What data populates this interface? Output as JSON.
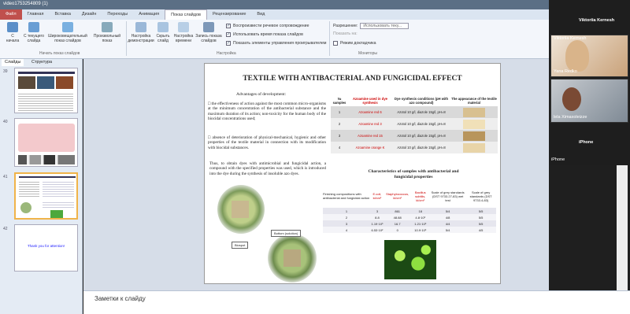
{
  "window": {
    "title": "video1753254809 (1)"
  },
  "tabs": [
    "Файл",
    "Главная",
    "Вставка",
    "Дизайн",
    "Переходы",
    "Анимация",
    "Показ слайдов",
    "Рецензирование",
    "Вид"
  ],
  "ribbon": {
    "buttons": [
      "С начала",
      "С текущего слайда",
      "Широковещательный показ слайдов",
      "Произвольный показ",
      "Настройка демонстрации",
      "Скрыть слайд",
      "Настройка времени",
      "Запись показа слайдов"
    ],
    "checks": [
      "Воспроизвести речевое сопровождение",
      "Использовать время показа слайдов",
      "Показать элементы управления проигрывателем"
    ],
    "resolution_label": "Разрешение:",
    "resolution_value": "Использовать теку...",
    "show_on_label": "Показать на:",
    "presenter_mode": "Режим докладчика",
    "groups": [
      "Начать показ слайдов",
      "Настройка",
      "Мониторы"
    ]
  },
  "leftpane": {
    "tabs": [
      "Слайды",
      "Структура"
    ],
    "numbers": [
      "39",
      "40",
      "41",
      "42"
    ],
    "thankyou": "Thank you for attention!"
  },
  "slide": {
    "title": "TEXTILE WITH ANTIBACTERIAL AND FUNGICIDAL EFFECT",
    "advantages_heading": "Advantages of development:",
    "bullet1": "the effectiveness of action against the most common micro-organisms at the minimum concentration of the antibacterial substance and the maximum duration of its action; non-toxicity for the human body of the biocidal concentrations used;",
    "bullet2": "absence of deterioration of physical-mechanical, hygienic and other properties of the textile material in connection with its modification with biocidal substances.",
    "para": "Thus, to obtain dyes with antimicrobial and fungicidal action, a compound with the specified properties was used, which is introduced into the dye during the synthesis of insoluble azo dyes.",
    "labels": [
      "Bottom (solution)",
      "Biospot"
    ],
    "table1": {
      "headers": [
        "№ samples",
        "Azoamine used in dye synthesis",
        "Dye synthesis conditions (pH with azo compound)",
        "The appearance of the textile material"
      ],
      "rows": [
        [
          "1",
          "Azoamine red 6",
          "Azotol 10 g/l, diazole 15g/l, pH=8"
        ],
        [
          "2",
          "Azoamine red 3",
          "Azotol 10 g/l, diazole 15g/l, pH=8"
        ],
        [
          "3",
          "Azoamine red 15",
          "Azotol 10 g/l, diazole 15g/l, pH=8"
        ],
        [
          "4",
          "Azoamine orange K",
          "Azotol 10 g/l, diazole 15g/l, pH=8"
        ]
      ]
    },
    "table2_title": "Characteristics of samples with antibacterial and fungicidal properties",
    "table2": {
      "headers": [
        "Finishing compositions with antibacterial and fungicidal action",
        "E.coli, kl/cm²",
        "Staphylococcus, kl/cm²",
        "Bacillus subtilis, kl/cm²",
        "Scale of grey standards (DST 9733.27-83) wet test",
        "Scale of grey standards (DST 9733.4-83)"
      ],
      "rows": [
        [
          "1",
          "3",
          "861",
          "18",
          "5/4",
          "5/5"
        ],
        [
          "2",
          "8.8",
          "48.88",
          "4.8·10³",
          "4/8",
          "5/5"
        ],
        [
          "3",
          "1.19·10³",
          "16.7",
          "1.21·10³",
          "4/4",
          "5/5"
        ],
        [
          "4",
          "6.53·10²",
          "0",
          "10.9·10³",
          "5/4",
          "4/5"
        ]
      ]
    }
  },
  "notes": {
    "placeholder": "Заметки к слайду"
  },
  "video": {
    "names": [
      "Viktoriia Kernesh",
      "Viktoriia Kernesh",
      "Yana Redko",
      "lela Ximaxoleizze",
      "iPhone",
      "iPhone"
    ]
  },
  "colors": {
    "file_tab": "#c0504d",
    "accent": "#f0b44a"
  }
}
